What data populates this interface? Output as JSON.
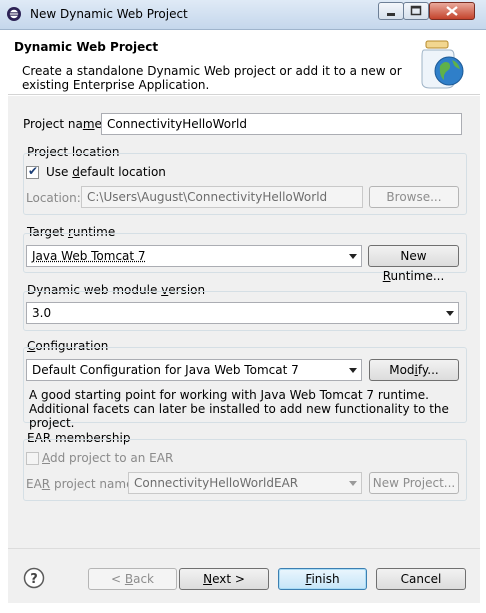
{
  "window": {
    "title": "New Dynamic Web Project",
    "app_icon": "eclipse-icon"
  },
  "banner": {
    "title": "Dynamic Web Project",
    "description": "Create a standalone Dynamic Web project or add it to a new or existing Enterprise Application.",
    "icon": "globe-jar-icon"
  },
  "project_name": {
    "label": "Project name:",
    "value": "ConnectivityHelloWorld"
  },
  "project_location": {
    "group_label": "Project location",
    "use_default_label": "Use default location",
    "use_default_checked": true,
    "location_label": "Location:",
    "location_value": "C:\\Users\\August\\ConnectivityHelloWorld",
    "browse_label": "Browse..."
  },
  "target_runtime": {
    "group_label": "Target runtime",
    "selected": "Java Web Tomcat 7",
    "new_runtime_label": "New Runtime..."
  },
  "module_version": {
    "group_label": "Dynamic web module version",
    "selected": "3.0"
  },
  "configuration": {
    "group_label": "Configuration",
    "selected": "Default Configuration for Java Web Tomcat 7",
    "modify_label": "Modify...",
    "description": "A good starting point for working with Java Web Tomcat 7 runtime. Additional facets can later be installed to add new functionality to the project."
  },
  "ear": {
    "group_label": "EAR membership",
    "add_label": "Add project to an EAR",
    "add_checked": false,
    "project_name_label": "EAR project name:",
    "project_name_value": "ConnectivityHelloWorldEAR",
    "new_project_label": "New Project..."
  },
  "footer": {
    "help_icon": "help-icon",
    "back_label": "< Back",
    "next_label": "Next >",
    "finish_label": "Finish",
    "cancel_label": "Cancel"
  }
}
